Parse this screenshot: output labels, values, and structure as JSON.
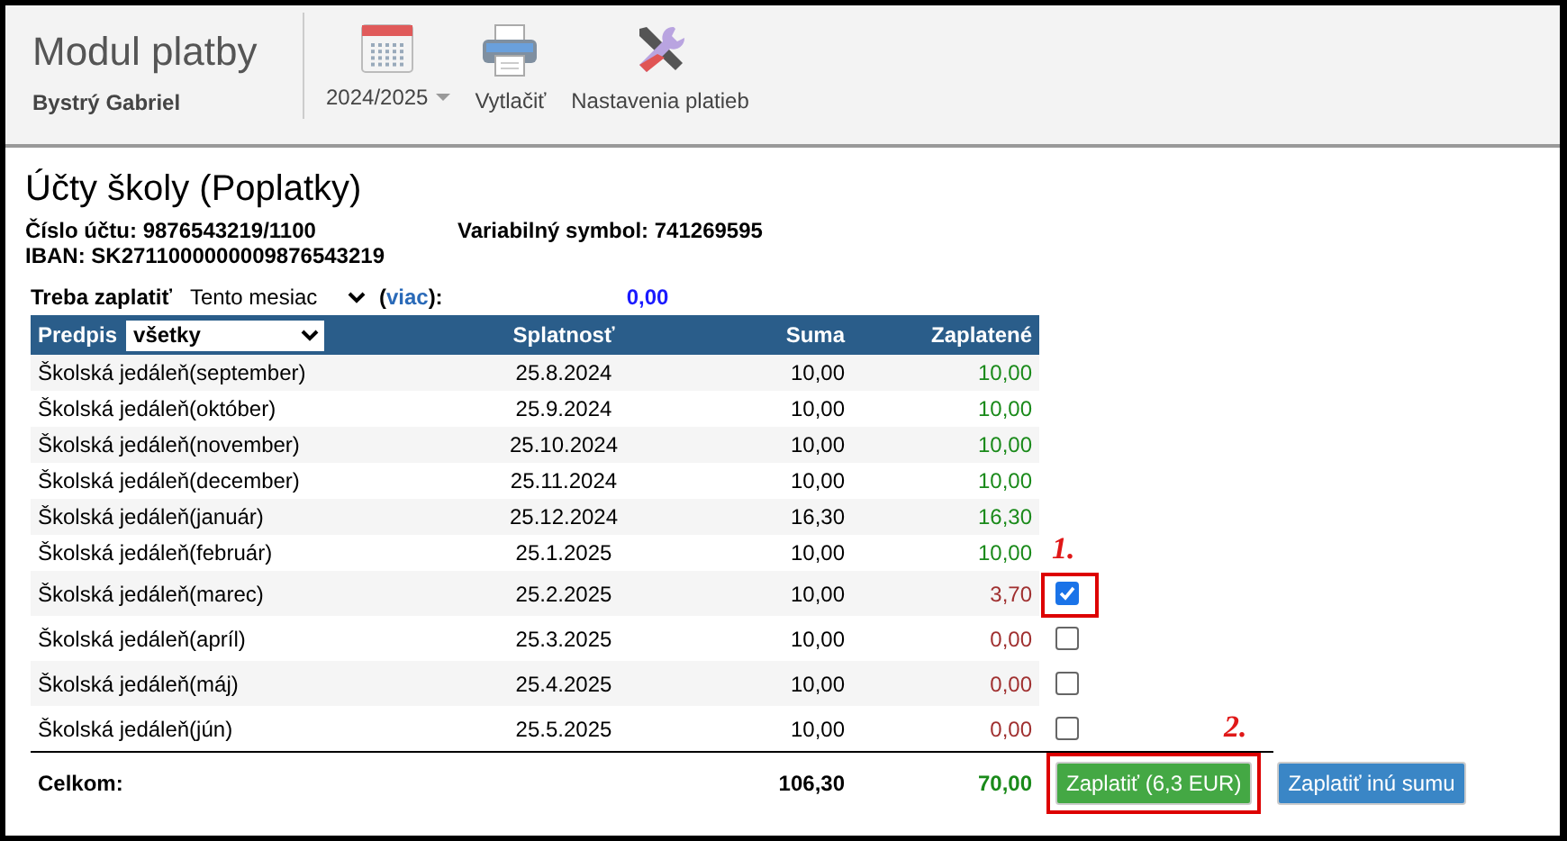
{
  "header": {
    "title": "Modul platby",
    "user": "Bystrý Gabriel",
    "toolbar": [
      {
        "kind": "year",
        "label": "2024/2025",
        "dropdown": true
      },
      {
        "kind": "print",
        "label": "Vytlačiť"
      },
      {
        "kind": "settings",
        "label": "Nastavenia platieb"
      }
    ]
  },
  "account": {
    "title": "Účty školy (Poplatky)",
    "account_number": "Číslo účtu: 9876543219/1100",
    "variable_symbol": "Variabilný symbol: 741269595",
    "iban": "IBAN: SK2711000000009876543219"
  },
  "due": {
    "label": "Treba zaplatiť",
    "period": "Tento mesiac",
    "more_before": "(",
    "more_link": "viac",
    "more_after": "):",
    "amount": "0,00"
  },
  "table": {
    "filter_label": "Predpis",
    "filter": "všetky",
    "columns": [
      "Splatnosť",
      "Suma",
      "Zaplatené"
    ],
    "rows": [
      {
        "item": "Školská jedáleň(september)",
        "due_date": "25.8.2024",
        "amount": "10,00",
        "paid": "10,00",
        "kind": "paid"
      },
      {
        "item": "Školská jedáleň(október)",
        "due_date": "25.9.2024",
        "amount": "10,00",
        "paid": "10,00",
        "kind": "paid"
      },
      {
        "item": "Školská jedáleň(november)",
        "due_date": "25.10.2024",
        "amount": "10,00",
        "paid": "10,00",
        "kind": "paid"
      },
      {
        "item": "Školská jedáleň(december)",
        "due_date": "25.11.2024",
        "amount": "10,00",
        "paid": "10,00",
        "kind": "paid"
      },
      {
        "item": "Školská jedáleň(január)",
        "due_date": "25.12.2024",
        "amount": "16,30",
        "paid": "16,30",
        "kind": "paid"
      },
      {
        "item": "Školská jedáleň(február)",
        "due_date": "25.1.2025",
        "amount": "10,00",
        "paid": "10,00",
        "kind": "paid"
      },
      {
        "item": "Školská jedáleň(marec)",
        "due_date": "25.2.2025",
        "amount": "10,00",
        "paid": "3,70",
        "kind": "open",
        "checked": true,
        "annotation": "1."
      },
      {
        "item": "Školská jedáleň(apríl)",
        "due_date": "25.3.2025",
        "amount": "10,00",
        "paid": "0,00",
        "kind": "open",
        "checked": false
      },
      {
        "item": "Školská jedáleň(máj)",
        "due_date": "25.4.2025",
        "amount": "10,00",
        "paid": "0,00",
        "kind": "open",
        "checked": false
      },
      {
        "item": "Školská jedáleň(jún)",
        "due_date": "25.5.2025",
        "amount": "10,00",
        "paid": "0,00",
        "kind": "open",
        "checked": false
      }
    ],
    "total": {
      "label": "Celkom:",
      "amount": "106,30",
      "paid": "70,00"
    },
    "buttons": [
      {
        "kind": "primary",
        "label": "Zaplatiť (6,3 EUR)",
        "annotation": "2."
      },
      {
        "kind": "secondary",
        "label": "Zaplatiť inú sumu"
      }
    ]
  }
}
